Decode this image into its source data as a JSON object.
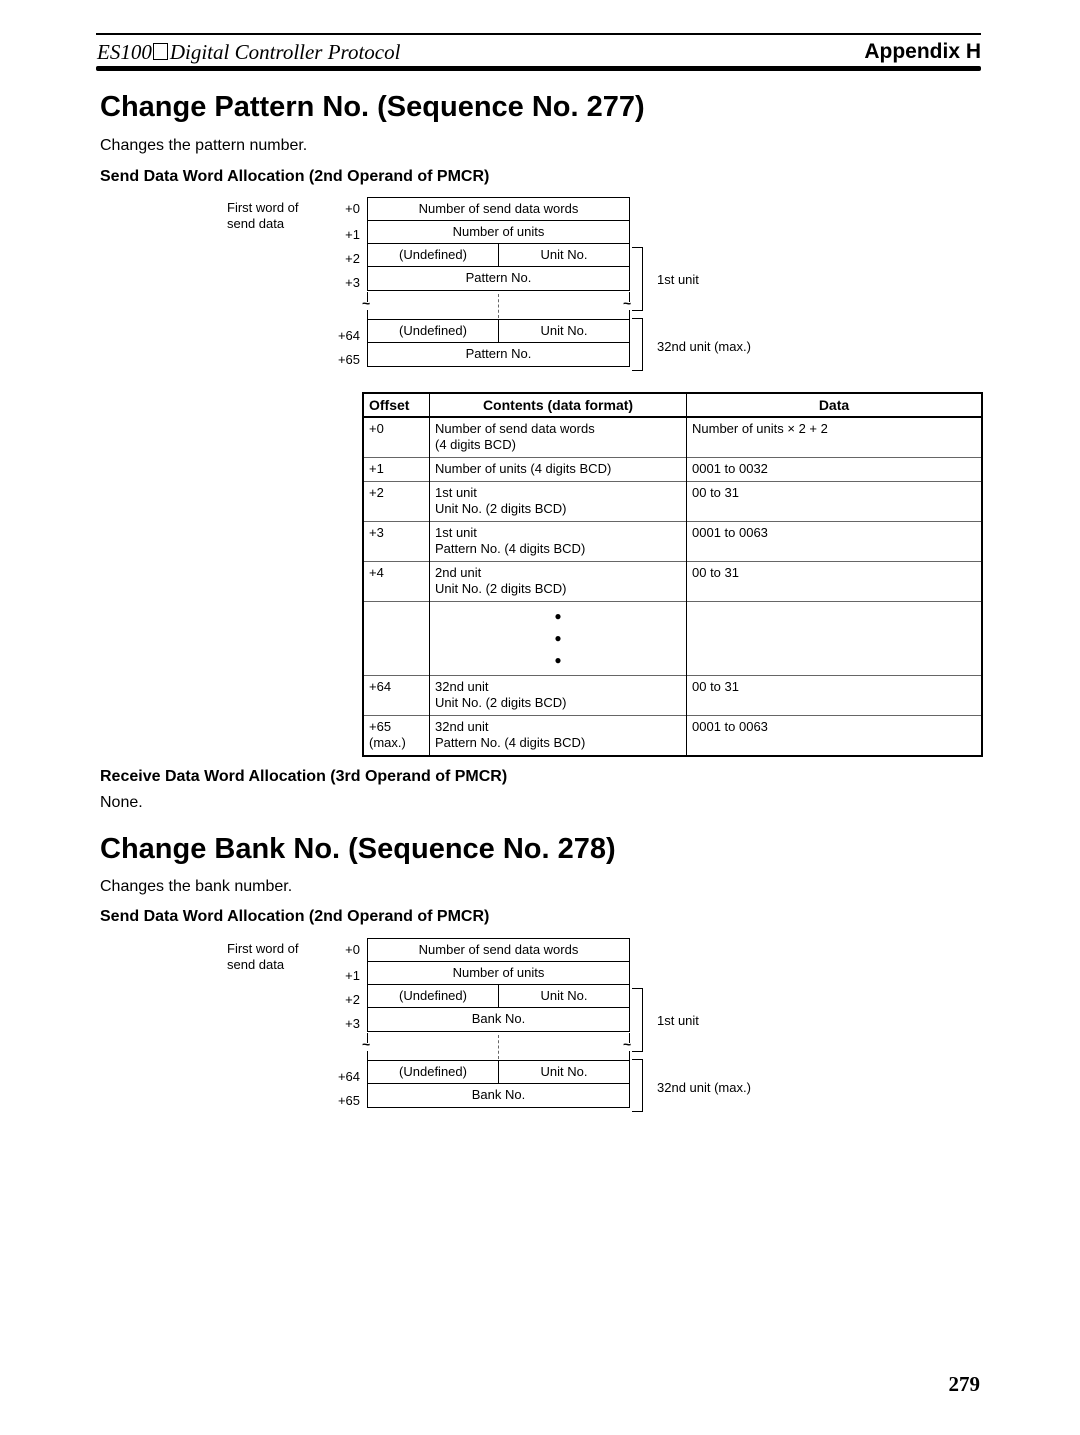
{
  "header": {
    "title_prefix": "ES100",
    "title_suffix": "Digital Controller Protocol",
    "appendix": "Appendix H"
  },
  "section1": {
    "title": "Change Pattern No. (Sequence No. 277)",
    "description": "Changes the pattern number.",
    "send_heading": "Send Data Word Allocation (2nd Operand of PMCR)",
    "diagram": {
      "first_word_label": "First word of send data",
      "offsets": [
        "+0",
        "+1",
        "+2",
        "+3",
        "+64",
        "+65"
      ],
      "cells": {
        "send_words": "Number of send data words",
        "units": "Number of units",
        "undefined": "(Undefined)",
        "unit_no": "Unit No.",
        "value_no": "Pattern No."
      },
      "brackets": [
        "1st unit",
        "32nd unit (max.)"
      ]
    },
    "table": {
      "headers": [
        "Offset",
        "Contents (data format)",
        "Data"
      ],
      "rows": [
        {
          "offset": "+0",
          "contents": [
            "Number of send data words",
            "(4 digits BCD)"
          ],
          "data": "Number of units × 2 + 2"
        },
        {
          "offset": "+1",
          "contents": [
            "Number of units (4 digits BCD)"
          ],
          "data": "0001 to 0032"
        },
        {
          "offset": "+2",
          "contents": [
            "1st unit",
            "Unit No. (2 digits BCD)"
          ],
          "data": "00 to 31"
        },
        {
          "offset": "+3",
          "contents": [
            "1st unit",
            "Pattern No. (4 digits BCD)"
          ],
          "data": "0001 to 0063"
        },
        {
          "offset": "+4",
          "contents": [
            "2nd unit",
            "Unit No. (2 digits BCD)"
          ],
          "data": "00 to 31"
        },
        {
          "offset": "",
          "contents": [
            "●",
            "●",
            "●"
          ],
          "data": ""
        },
        {
          "offset": "+64",
          "contents": [
            "32nd unit",
            "Unit No. (2 digits BCD)"
          ],
          "data": "00 to 31"
        },
        {
          "offset": "+65",
          "offset2": "(max.)",
          "contents": [
            "32nd unit",
            "Pattern No. (4 digits BCD)"
          ],
          "data": "0001 to 0063"
        }
      ]
    },
    "receive_heading": "Receive Data Word Allocation (3rd Operand of PMCR)",
    "receive_text": "None."
  },
  "section2": {
    "title": "Change Bank No. (Sequence No. 278)",
    "description": "Changes the bank number.",
    "send_heading": "Send Data Word Allocation (2nd Operand of PMCR)",
    "diagram": {
      "first_word_label": "First word of send data",
      "offsets": [
        "+0",
        "+1",
        "+2",
        "+3",
        "+64",
        "+65"
      ],
      "cells": {
        "send_words": "Number of send data words",
        "units": "Number of units",
        "undefined": "(Undefined)",
        "unit_no": "Unit No.",
        "value_no": "Bank No."
      },
      "brackets": [
        "1st unit",
        "32nd unit (max.)"
      ]
    }
  },
  "page_number": "279"
}
